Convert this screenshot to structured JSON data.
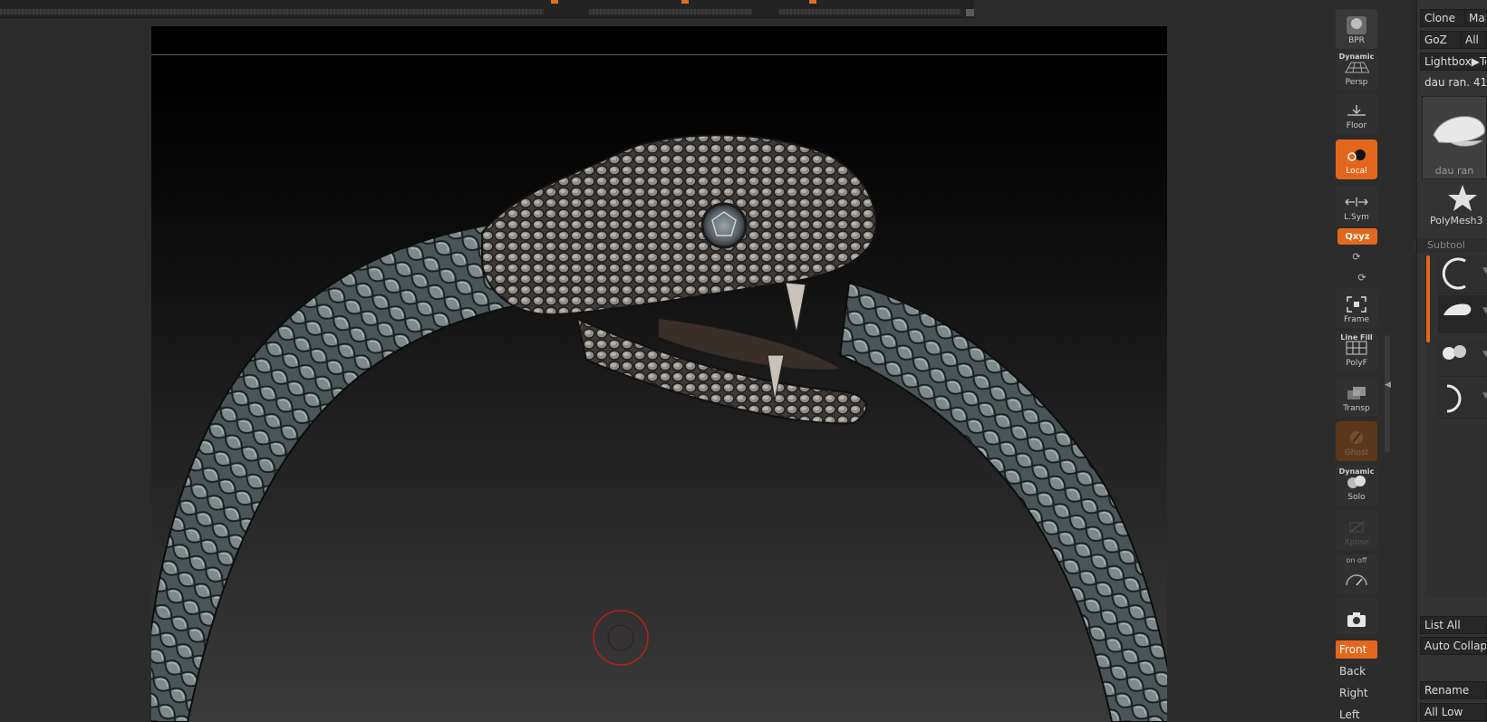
{
  "shelf": {
    "bpr_label": "BPR",
    "persp_top": "Dynamic",
    "persp_label": "Persp",
    "floor_label": "Floor",
    "local_label": "Local",
    "lsym_label": "L.Sym",
    "xyz_label": "Qxyz",
    "frame_label": "Frame",
    "polyf_top": "Line Fill",
    "polyf_label": "PolyF",
    "transp_label": "Transp",
    "ghost_label": "Ghost",
    "solo_top": "Dynamic",
    "solo_label": "Solo",
    "xpose_label": "Xpose",
    "onoff_label": "on  off",
    "views": [
      "Front",
      "Back",
      "Right",
      "Left"
    ],
    "active_view": "Front"
  },
  "panel": {
    "clone_label": "Clone",
    "make_label": "Mak",
    "goz_label": "GoZ",
    "all_label": "All",
    "lightbox_label": "Lightbox▶To",
    "tool_name_readout": "dau ran. 41",
    "thumb_main_caption": "dau ran",
    "thumb_poly_caption": "PolyMesh3",
    "subtool_header": "Subtool",
    "list_all_label": "List All",
    "auto_collapse_label": "Auto Collaps",
    "rename_label": "Rename",
    "all_low_label": "All Low"
  },
  "colors": {
    "accent": "#e2671c",
    "panel_bg": "#333333",
    "shelf_bg": "#2c2c2c",
    "canvas_bg_top": "#000000",
    "canvas_bg_bottom": "#3a3a3a"
  }
}
